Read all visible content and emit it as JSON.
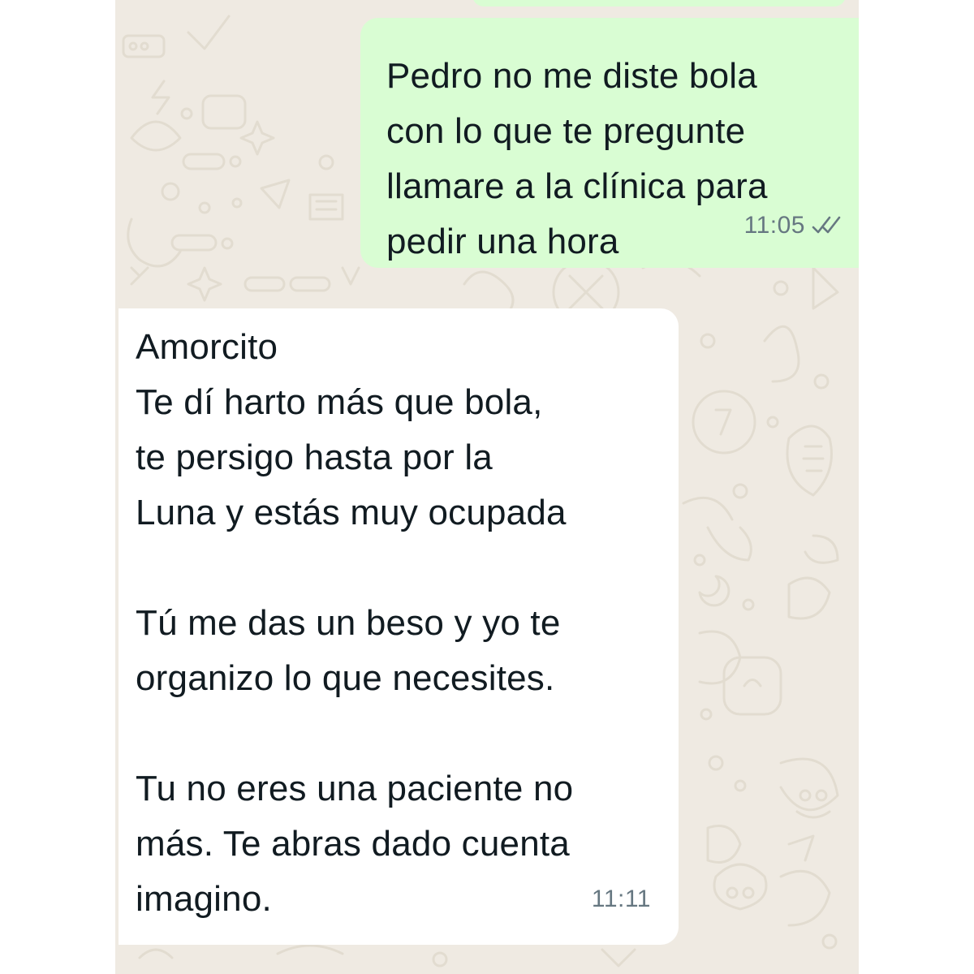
{
  "messages": {
    "outgoing": {
      "lines": [
        "Pedro no me diste bola",
        "con lo que te pregunte",
        "llamare a la clínica para",
        "pedir una hora"
      ],
      "time": "11:05",
      "status_icon": "double-check-icon"
    },
    "incoming": {
      "lines": [
        "Amorcito",
        "Te dí harto más que bola,",
        "te persigo hasta por la",
        "Luna y estás muy ocupada",
        "",
        "Tú me das un beso y yo te",
        "organizo lo que necesites.",
        "",
        "Tu no eres una paciente no",
        "más. Te abras dado cuenta",
        "imagino."
      ],
      "time": "11:11"
    }
  },
  "colors": {
    "chat_background": "#efeae2",
    "outgoing_bubble": "#d9fdd3",
    "incoming_bubble": "#ffffff",
    "meta_text": "#667781",
    "doodle_stroke": "#e2dcd0"
  }
}
